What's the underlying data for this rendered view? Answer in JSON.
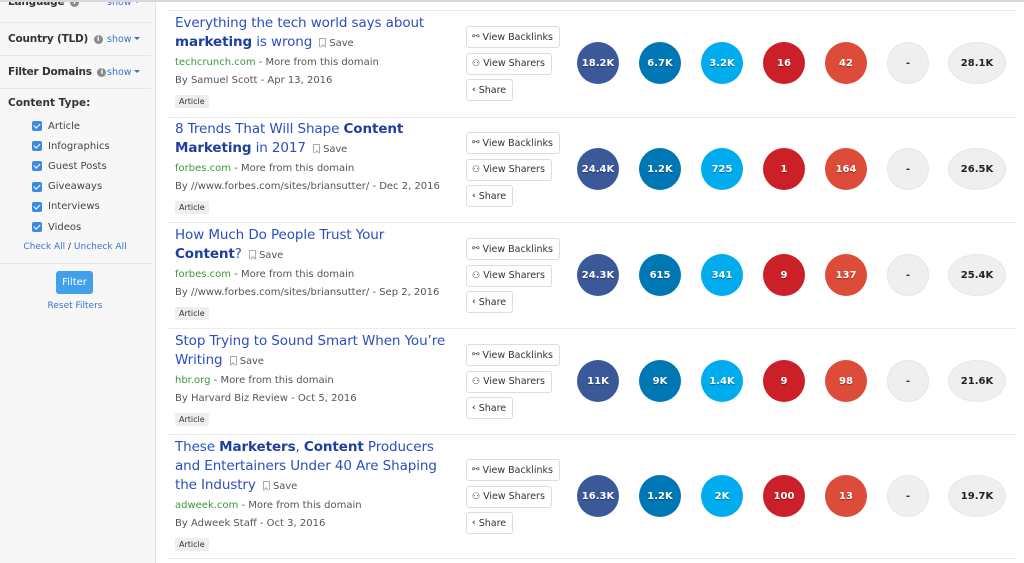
{
  "sidebar": {
    "filters": [
      {
        "label": "Language",
        "toggle": "show"
      },
      {
        "label": "Country (TLD)",
        "toggle": "show"
      },
      {
        "label": "Filter Domains",
        "toggle": "show"
      }
    ],
    "content_type_label": "Content Type:",
    "content_types": [
      {
        "label": "Article",
        "checked": true
      },
      {
        "label": "Infographics",
        "checked": true
      },
      {
        "label": "Guest Posts",
        "checked": true
      },
      {
        "label": "Giveaways",
        "checked": true
      },
      {
        "label": "Interviews",
        "checked": true
      },
      {
        "label": "Videos",
        "checked": true
      }
    ],
    "check_all": "Check All",
    "check_sep": "/",
    "uncheck_all": "Uncheck All",
    "filter_button": "Filter",
    "reset_filters": "Reset Filters"
  },
  "actions": {
    "view_backlinks": "View Backlinks",
    "view_sharers": "View Sharers",
    "share": "Share",
    "save": "Save",
    "more_from_domain": "More from this domain"
  },
  "metric_colors": {
    "facebook": "#3b5998",
    "linkedin": "#0077b5",
    "twitter": "#00aced",
    "pinterest": "#cb2027",
    "googleplus": "#dd4b39",
    "reddit": "#efefef",
    "total": "#efefef"
  },
  "results": [
    {
      "title_parts": [
        {
          "text": "Everything the tech world says about ",
          "bold": false
        },
        {
          "text": "marketing",
          "bold": true
        },
        {
          "text": " is wrong",
          "bold": false
        }
      ],
      "domain": "techcrunch.com",
      "byline": "By Samuel Scott - Apr 13, 2016",
      "tag": "Article",
      "metrics": {
        "facebook": "18.2K",
        "linkedin": "6.7K",
        "twitter": "3.2K",
        "pinterest": "16",
        "googleplus": "42",
        "reddit": "-",
        "total": "28.1K"
      }
    },
    {
      "title_parts": [
        {
          "text": "8 Trends That Will Shape ",
          "bold": false
        },
        {
          "text": "Content Marketing",
          "bold": true
        },
        {
          "text": " in 2017",
          "bold": false
        }
      ],
      "domain": "forbes.com",
      "byline": "By //www.forbes.com/sites/briansutter/ - Dec 2, 2016",
      "tag": "Article",
      "metrics": {
        "facebook": "24.4K",
        "linkedin": "1.2K",
        "twitter": "725",
        "pinterest": "1",
        "googleplus": "164",
        "reddit": "-",
        "total": "26.5K"
      }
    },
    {
      "title_parts": [
        {
          "text": "How Much Do People Trust Your ",
          "bold": false
        },
        {
          "text": "Content",
          "bold": true
        },
        {
          "text": "?",
          "bold": false
        }
      ],
      "domain": "forbes.com",
      "byline": "By //www.forbes.com/sites/briansutter/ - Sep 2, 2016",
      "tag": "Article",
      "metrics": {
        "facebook": "24.3K",
        "linkedin": "615",
        "twitter": "341",
        "pinterest": "9",
        "googleplus": "137",
        "reddit": "-",
        "total": "25.4K"
      }
    },
    {
      "title_parts": [
        {
          "text": "Stop Trying to Sound Smart When You’re Writing",
          "bold": false
        }
      ],
      "domain": "hbr.org",
      "byline": "By Harvard Biz Review - Oct 5, 2016",
      "tag": "Article",
      "metrics": {
        "facebook": "11K",
        "linkedin": "9K",
        "twitter": "1.4K",
        "pinterest": "9",
        "googleplus": "98",
        "reddit": "-",
        "total": "21.6K"
      }
    },
    {
      "title_parts": [
        {
          "text": "These ",
          "bold": false
        },
        {
          "text": "Marketers",
          "bold": true
        },
        {
          "text": ", ",
          "bold": false
        },
        {
          "text": "Content",
          "bold": true
        },
        {
          "text": " Producers and Entertainers Under 40 Are Shaping the Industry",
          "bold": false
        }
      ],
      "domain": "adweek.com",
      "byline": "By Adweek Staff - Oct 3, 2016",
      "tag": "Article",
      "metrics": {
        "facebook": "16.3K",
        "linkedin": "1.2K",
        "twitter": "2K",
        "pinterest": "100",
        "googleplus": "13",
        "reddit": "-",
        "total": "19.7K"
      }
    }
  ]
}
